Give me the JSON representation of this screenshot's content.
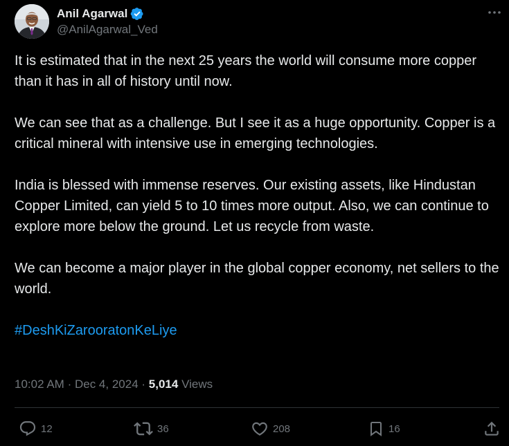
{
  "author": {
    "display_name": "Anil Agarwal",
    "handle": "@AnilAgarwal_Ved",
    "verified": true
  },
  "tweet": {
    "paragraphs": [
      "It is estimated that in the next 25 years the world will consume more copper than it has in all of history until now.",
      "We can see that as a challenge. But I see it as a huge opportunity. Copper is a critical mineral with intensive use in emerging technologies.",
      "India is blessed with immense reserves. Our existing assets, like Hindustan Copper Limited, can yield 5 to 10 times more output. Also, we can continue to explore more below the ground. Let us recycle from waste.",
      "We can become a major player in the global copper economy, net sellers to the world."
    ],
    "hashtag": "#DeshKiZarooratonKeLiye"
  },
  "meta": {
    "time": "10:02 AM",
    "separator": "·",
    "date": "Dec 4, 2024",
    "views_count": "5,014",
    "views_label": "Views"
  },
  "actions": {
    "replies": "12",
    "reposts": "36",
    "likes": "208",
    "bookmarks": "16"
  },
  "icons": {
    "verified": "verified-badge-icon",
    "more": "more-dots-icon",
    "reply": "reply-icon",
    "repost": "repost-icon",
    "like": "heart-icon",
    "bookmark": "bookmark-icon",
    "share": "share-icon"
  },
  "colors": {
    "background": "#000000",
    "text": "#e7e9ea",
    "muted": "#71767b",
    "accent": "#1d9bf0",
    "divider": "#2f3336"
  }
}
